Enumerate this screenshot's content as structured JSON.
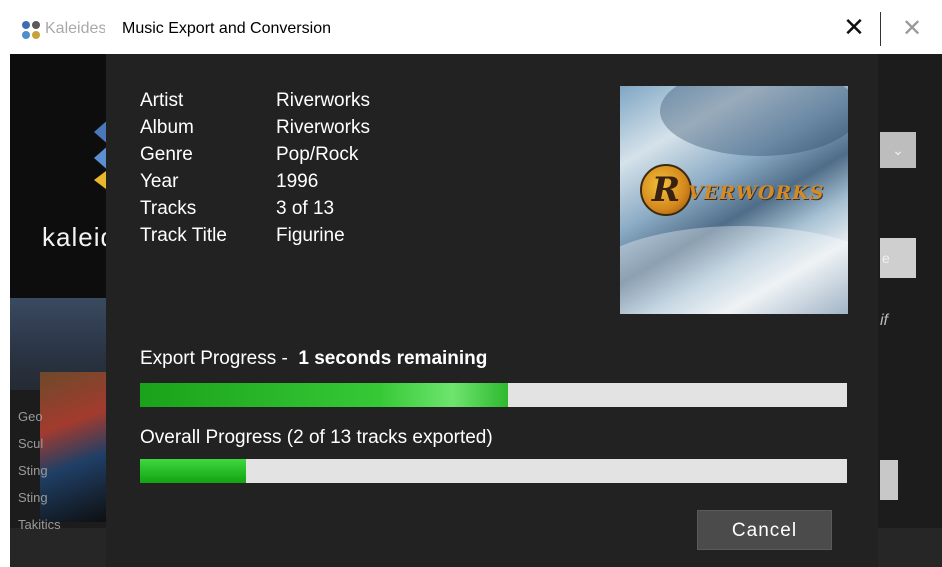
{
  "background_app": {
    "title": "Kaleidescape",
    "brand_name": "kaleidescape",
    "list_items": [
      "Geo",
      "Scul",
      "Sting",
      "Sting",
      "Takitics"
    ],
    "right_text": "if"
  },
  "dialog": {
    "title": "Music Export and Conversion",
    "close_symbol": "✕",
    "info": [
      {
        "label": "Artist",
        "value": "Riverworks"
      },
      {
        "label": "Album",
        "value": "Riverworks"
      },
      {
        "label": "Genre",
        "value": "Pop/Rock"
      },
      {
        "label": "Year",
        "value": "1996"
      },
      {
        "label": "Tracks",
        "value": "3 of 13"
      },
      {
        "label": "Track Title",
        "value": "Figurine"
      }
    ],
    "cover": {
      "badge_letter": "R",
      "text": "VERWORKS"
    },
    "export_progress": {
      "label_prefix": "Export Progress -",
      "label_remaining": "1 seconds remaining",
      "fraction": 0.52
    },
    "overall_progress": {
      "label": "Overall Progress (2 of 13 tracks exported)",
      "fraction": 0.15
    },
    "cancel_label": "Cancel"
  },
  "colors": {
    "dialog_background": "#222222",
    "progress_green": "#2fb82f",
    "progress_track": "#e3e3e3",
    "button_background": "#4b4b4b"
  },
  "icons": {
    "background_app_logo": "kaleidescape-logo-icon",
    "close": "close-icon"
  }
}
